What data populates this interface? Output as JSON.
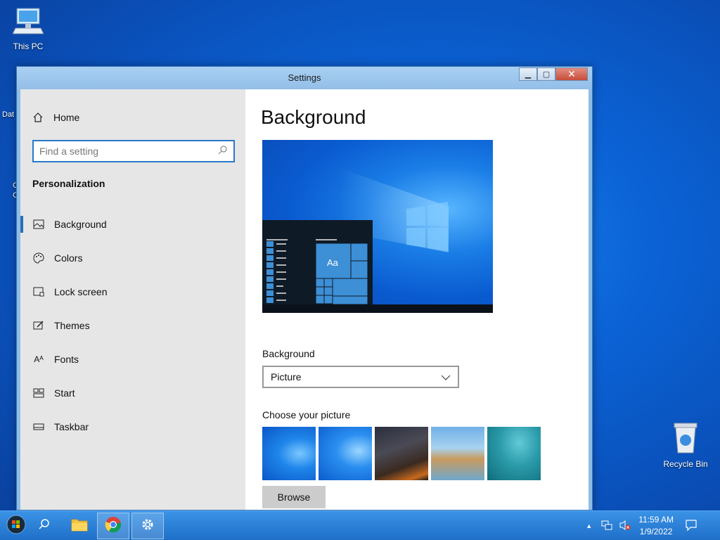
{
  "desktop": {
    "this_pc": "This PC",
    "recycle_bin": "Recycle Bin",
    "stub_1": "Dat",
    "stub_2": "C",
    "stub_3": "C"
  },
  "window": {
    "title": "Settings",
    "minimize_icon": "minimize-icon",
    "restore_icon": "restore-icon",
    "close_icon": "close-icon"
  },
  "nav": {
    "home": "Home",
    "search_placeholder": "Find a setting",
    "section": "Personalization",
    "items": [
      {
        "label": "Background",
        "icon": "image-icon",
        "active": true
      },
      {
        "label": "Colors",
        "icon": "palette-icon"
      },
      {
        "label": "Lock screen",
        "icon": "lock-screen-icon"
      },
      {
        "label": "Themes",
        "icon": "brush-icon"
      },
      {
        "label": "Fonts",
        "icon": "font-icon"
      },
      {
        "label": "Start",
        "icon": "start-tiles-icon"
      },
      {
        "label": "Taskbar",
        "icon": "taskbar-icon"
      }
    ]
  },
  "content": {
    "title": "Background",
    "preview_tile_text": "Aa",
    "background_label": "Background",
    "background_value": "Picture",
    "choose_label": "Choose your picture",
    "browse": "Browse"
  },
  "taskbar": {
    "time": "11:59 AM",
    "date": "1/9/2022"
  },
  "colors": {
    "accent": "#2a78c8",
    "desktop": "#0b63d6",
    "nav_bg": "#e6e6e6"
  }
}
